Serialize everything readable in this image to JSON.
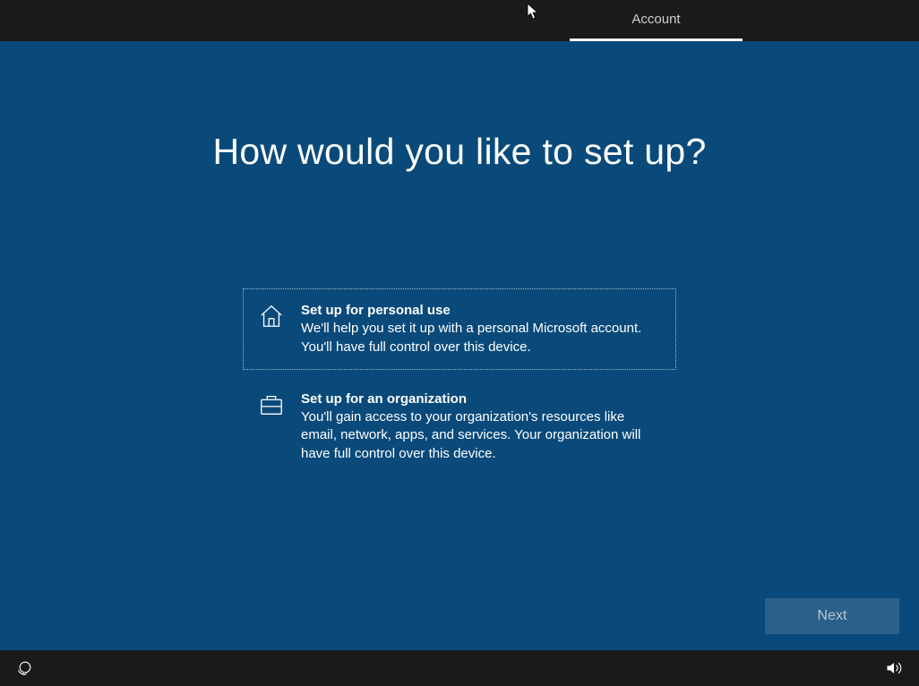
{
  "tab": {
    "label": "Account"
  },
  "heading": "How would you like to set up?",
  "options": [
    {
      "title": "Set up for personal use",
      "desc": "We'll help you set it up with a personal Microsoft account. You'll have full control over this device."
    },
    {
      "title": "Set up for an organization",
      "desc": "You'll gain access to your organization's resources like email, network, apps, and services. Your organization will have full control over this device."
    }
  ],
  "buttons": {
    "next": "Next"
  }
}
